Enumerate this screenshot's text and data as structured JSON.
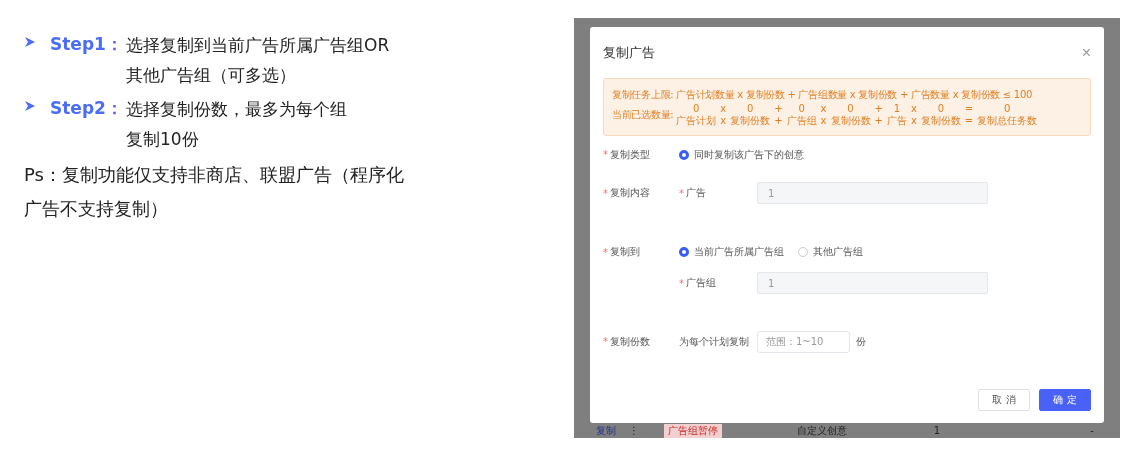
{
  "notes": {
    "steps": [
      {
        "label": "Step1：",
        "lines": [
          "选择复制到当前广告所属广告组OR",
          "其他广告组（可多选）"
        ]
      },
      {
        "label": "Step2：",
        "lines": [
          "选择复制份数，最多为每个组",
          "复制10份"
        ]
      }
    ],
    "ps": "Ps：复制功能仅支持非商店、联盟广告（程序化广告不支持复制）"
  },
  "dialog": {
    "title": "复制广告",
    "close": "×",
    "alert": {
      "limit_label": "复制任务上限:",
      "limit_formula": "广告计划数量 x 复制份数 + 广告组数量 x 复制份数 + 广告数量 x 复制份数 ≤ 100",
      "current_label": "当前已选数量:",
      "terms": [
        {
          "value": "0",
          "label": "广告计划"
        },
        {
          "value": "x",
          "label": "x"
        },
        {
          "value": "0",
          "label": "复制份数"
        },
        {
          "value": "+",
          "label": "+"
        },
        {
          "value": "0",
          "label": "广告组"
        },
        {
          "value": "x",
          "label": "x"
        },
        {
          "value": "0",
          "label": "复制份数"
        },
        {
          "value": "+",
          "label": "+"
        },
        {
          "value": "1",
          "label": "广告"
        },
        {
          "value": "x",
          "label": "x"
        },
        {
          "value": "0",
          "label": "复制份数"
        },
        {
          "value": "=",
          "label": "="
        },
        {
          "value": "0",
          "label": "复制总任务数"
        }
      ]
    },
    "copy_type": {
      "label": "复制类型",
      "required_mark": "*",
      "options": [
        {
          "label": "同时复制该广告下的创意",
          "selected": true
        }
      ]
    },
    "copy_content": {
      "label": "复制内容",
      "required_mark": "*",
      "field_label": "广告",
      "field_required_mark": "*",
      "value": "1"
    },
    "copy_to": {
      "label": "复制到",
      "required_mark": "*",
      "options": [
        {
          "label": "当前广告所属广告组",
          "selected": true
        },
        {
          "label": "其他广告组",
          "selected": false
        }
      ],
      "field_label": "广告组",
      "field_required_mark": "*",
      "value": "1"
    },
    "copies": {
      "label": "复制份数",
      "required_mark": "*",
      "prefix": "为每个计划复制",
      "placeholder": "范围：1~10",
      "suffix": "份"
    },
    "buttons": [
      {
        "label": "取 消",
        "kind": "secondary"
      },
      {
        "label": "确 定",
        "kind": "primary"
      }
    ]
  },
  "table_row": {
    "action": "复制",
    "more": "⋮",
    "status": "广告组暂停",
    "creative": "自定义创意",
    "count": "1",
    "column_6": "-"
  }
}
